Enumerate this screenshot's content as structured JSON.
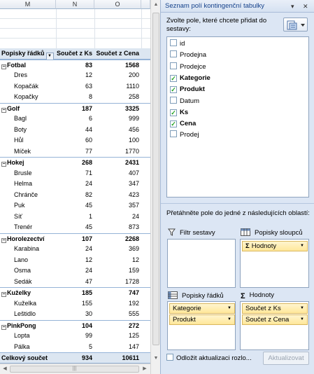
{
  "sheet": {
    "columns": [
      "M",
      "N",
      "O"
    ],
    "pivot": {
      "header": {
        "rows_label": "Popisky řádků",
        "col1": "Součet z Ks",
        "col2": "Součet z Cena"
      },
      "groups": [
        {
          "name": "Fotbal",
          "ks": "83",
          "cena": "1568",
          "items": [
            {
              "name": "Dres",
              "ks": "12",
              "cena": "200"
            },
            {
              "name": "Kopačák",
              "ks": "63",
              "cena": "1110"
            },
            {
              "name": "Kopačky",
              "ks": "8",
              "cena": "258"
            }
          ]
        },
        {
          "name": "Golf",
          "ks": "187",
          "cena": "3325",
          "items": [
            {
              "name": "Bagl",
              "ks": "6",
              "cena": "999"
            },
            {
              "name": "Boty",
              "ks": "44",
              "cena": "456"
            },
            {
              "name": "Hůl",
              "ks": "60",
              "cena": "100"
            },
            {
              "name": "Míček",
              "ks": "77",
              "cena": "1770"
            }
          ]
        },
        {
          "name": "Hokej",
          "ks": "268",
          "cena": "2431",
          "items": [
            {
              "name": "Brusle",
              "ks": "71",
              "cena": "407"
            },
            {
              "name": "Helma",
              "ks": "24",
              "cena": "347"
            },
            {
              "name": "Chránče",
              "ks": "82",
              "cena": "423"
            },
            {
              "name": "Puk",
              "ks": "45",
              "cena": "357"
            },
            {
              "name": "Síť",
              "ks": "1",
              "cena": "24"
            },
            {
              "name": "Trenér",
              "ks": "45",
              "cena": "873"
            }
          ]
        },
        {
          "name": "Horolezectví",
          "ks": "107",
          "cena": "2268",
          "items": [
            {
              "name": "Karabina",
              "ks": "24",
              "cena": "369"
            },
            {
              "name": "Lano",
              "ks": "12",
              "cena": "12"
            },
            {
              "name": "Osma",
              "ks": "24",
              "cena": "159"
            },
            {
              "name": "Sedák",
              "ks": "47",
              "cena": "1728"
            }
          ]
        },
        {
          "name": "Kuželky",
          "ks": "185",
          "cena": "747",
          "items": [
            {
              "name": "Kuželka",
              "ks": "155",
              "cena": "192"
            },
            {
              "name": "Leštidlo",
              "ks": "30",
              "cena": "555"
            }
          ]
        },
        {
          "name": "PinkPong",
          "ks": "104",
          "cena": "272",
          "items": [
            {
              "name": "Lopta",
              "ks": "99",
              "cena": "125"
            },
            {
              "name": "Pálka",
              "ks": "5",
              "cena": "147"
            }
          ]
        }
      ],
      "total": {
        "label": "Celkový součet",
        "ks": "934",
        "cena": "10611"
      }
    }
  },
  "panel": {
    "title": "Seznam polí kontingenční tabulky",
    "title_controls": [
      "▾",
      "✕"
    ],
    "choose_label": "Zvolte pole, které chcete přidat do sestavy:",
    "fields": [
      {
        "name": "id",
        "checked": false
      },
      {
        "name": "Prodejna",
        "checked": false
      },
      {
        "name": "Prodejce",
        "checked": false
      },
      {
        "name": "Kategorie",
        "checked": true
      },
      {
        "name": "Produkt",
        "checked": true
      },
      {
        "name": "Datum",
        "checked": false
      },
      {
        "name": "Ks",
        "checked": true
      },
      {
        "name": "Cena",
        "checked": true
      },
      {
        "name": "Prodej",
        "checked": false
      }
    ],
    "drag_label": "Přetáhněte pole do jedné z následujících oblastí:",
    "areas": {
      "filter": {
        "title": "Filtr sestavy",
        "items": []
      },
      "columns": {
        "title": "Popisky sloupců",
        "items": [
          "Hodnoty"
        ]
      },
      "rows": {
        "title": "Popisky řádků",
        "items": [
          "Kategorie",
          "Produkt"
        ]
      },
      "values": {
        "title": "Hodnoty",
        "items": [
          "Součet z Ks",
          "Součet z Cena"
        ]
      }
    },
    "defer_label": "Odložit aktualizaci rozlo...",
    "defer_checked": false,
    "update_button": "Aktualizovat"
  },
  "colors": {
    "pivot_header_bg": "#dce6f1",
    "panel_bg": "#dce6f4",
    "chip_bg": "#ffe79a",
    "check_green": "#21a121"
  }
}
